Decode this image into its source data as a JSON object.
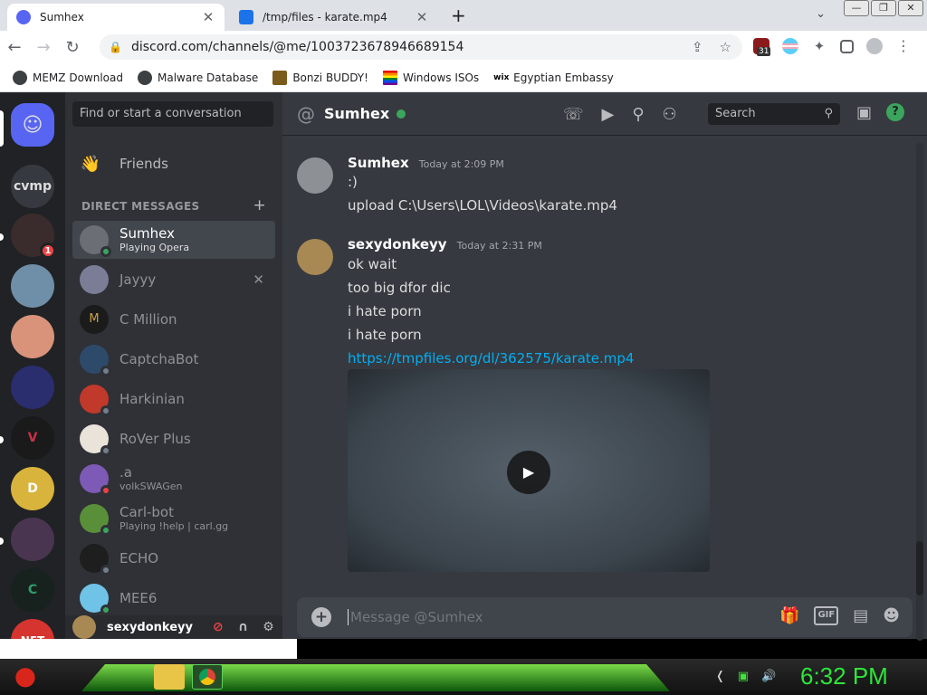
{
  "browser": {
    "tabs": [
      {
        "title": "Sumhex",
        "close": "✕"
      },
      {
        "title": "/tmp/files - karate.mp4",
        "close": "✕"
      }
    ],
    "new_tab": "+",
    "tab_menu": "⌄",
    "window_buttons": [
      "—",
      "❐",
      "✕"
    ],
    "url": "discord.com/channels/@me/1003723678946689154",
    "ext_badge": "31",
    "bookmarks": [
      "MEMZ Download",
      "Malware Database",
      "Bonzi BUDDY!",
      "Windows ISOs",
      "Egyptian Embassy"
    ]
  },
  "discord": {
    "search_placeholder": "Find or start a conversation",
    "friends_label": "Friends",
    "dm_header": "DIRECT MESSAGES",
    "servers": [
      {
        "label": "cvmp"
      },
      {
        "badge": "1"
      },
      {
        "label": "NFT"
      }
    ],
    "dms": [
      {
        "name": "Sumhex",
        "sub": "Playing Opera",
        "status": "#3ba55d",
        "avatar": "#6b6e74"
      },
      {
        "name": "Jayyy",
        "sub": "",
        "status": "",
        "avatar": "#7a7d95"
      },
      {
        "name": "C Million",
        "sub": "",
        "status": "",
        "avatar": "#1b1b1b"
      },
      {
        "name": "CaptchaBot",
        "sub": "",
        "status": "#747f8d",
        "avatar": "#2e4a6b"
      },
      {
        "name": "Harkinian",
        "sub": "",
        "status": "#747f8d",
        "avatar": "#c0392b"
      },
      {
        "name": "RoVer Plus",
        "sub": "",
        "status": "#747f8d",
        "avatar": "#e9e3da"
      },
      {
        "name": ".a",
        "sub": "volkSWAGen",
        "status": "#ed4245",
        "avatar": "#7d5ab5"
      },
      {
        "name": "Carl-bot",
        "sub": "Playing !help | carl.gg",
        "status": "#3ba55d",
        "avatar": "#5a8f3a"
      },
      {
        "name": "ECHO",
        "sub": "",
        "status": "#747f8d",
        "avatar": "#1e1e1e"
      },
      {
        "name": "MEE6",
        "sub": "",
        "status": "#3ba55d",
        "avatar": "#6fc3e7"
      }
    ],
    "dm_close": "✕",
    "current_user": "sexydonkeyy",
    "channel": {
      "name": "Sumhex",
      "search": "Search"
    },
    "messages": [
      {
        "author": "Sumhex",
        "time": "Today at 2:09 PM",
        "lines": [
          ":)",
          "upload C:\\Users\\LOL\\Videos\\karate.mp4"
        ]
      },
      {
        "author": "sexydonkeyy",
        "time": "Today at 2:31 PM",
        "lines": [
          "ok wait",
          "too big dfor dic",
          "i hate porn",
          "i hate porn"
        ],
        "link": "https://tmpfiles.org/dl/362575/karate.mp4"
      }
    ],
    "composer_placeholder": "Message @Sumhex",
    "gif": "GIF"
  },
  "taskbar": {
    "clock": "6:32 PM"
  },
  "colors": {
    "blurple": "#5865f2",
    "online": "#3ba55d",
    "link": "#00aff4",
    "clock": "#2ee53a"
  }
}
